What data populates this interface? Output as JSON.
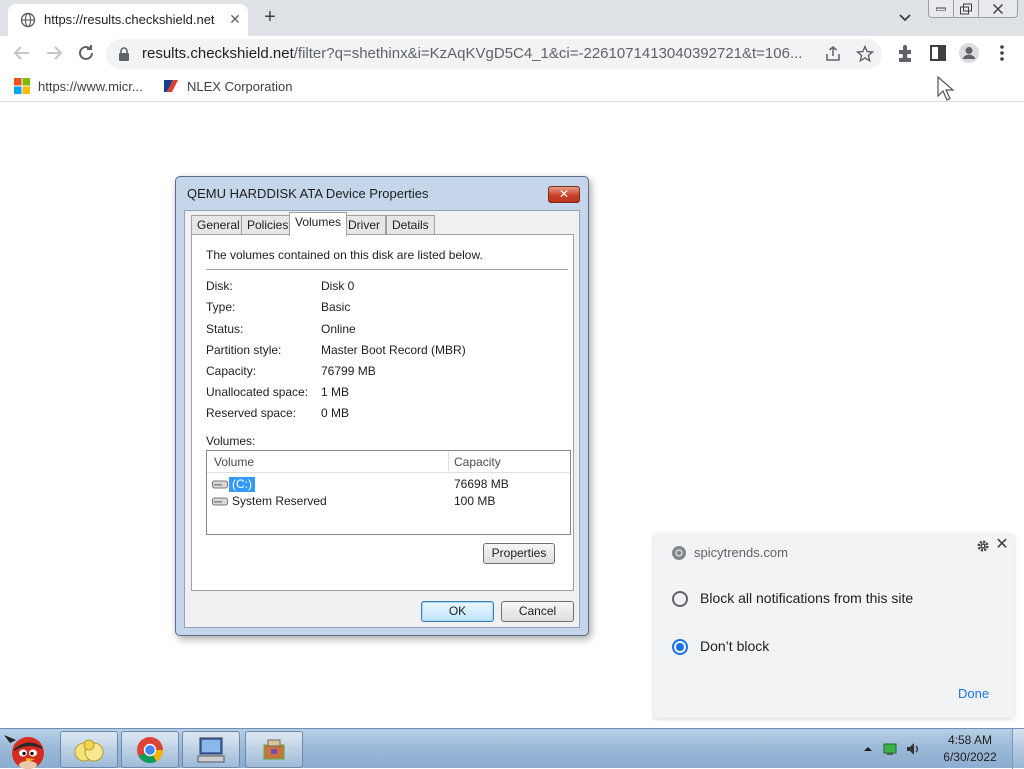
{
  "browser": {
    "tab_title": "https://results.checkshield.net",
    "url_host": "results.checkshield.net",
    "url_rest": "/filter?q=shethinx&i=KzAqKVgD5C4_1&ci=-2261071413040392721&t=106...",
    "bookmarks": [
      {
        "label": "https://www.micr...",
        "icon": "microsoft-logo-icon"
      },
      {
        "label": "NLEX Corporation",
        "icon": "nlex-logo-icon"
      }
    ]
  },
  "dialog": {
    "title": "QEMU HARDDISK ATA Device Properties",
    "close_label": "✕",
    "tabs": [
      "General",
      "Policies",
      "Volumes",
      "Driver",
      "Details"
    ],
    "active_tab": "Volumes",
    "intro": "The volumes contained on this disk are listed below.",
    "properties": [
      {
        "label": "Disk:",
        "value": "Disk 0"
      },
      {
        "label": "Type:",
        "value": "Basic"
      },
      {
        "label": "Status:",
        "value": "Online"
      },
      {
        "label": "Partition style:",
        "value": "Master Boot Record (MBR)"
      },
      {
        "label": "Capacity:",
        "value": "76799 MB"
      },
      {
        "label": "Unallocated space:",
        "value": "1 MB"
      },
      {
        "label": "Reserved space:",
        "value": "0 MB"
      }
    ],
    "volumes_label": "Volumes:",
    "volume_columns": [
      "Volume",
      "Capacity"
    ],
    "volumes": [
      {
        "name": "(C:)",
        "capacity": "76698 MB",
        "selected": true
      },
      {
        "name": "System Reserved",
        "capacity": "100 MB",
        "selected": false
      }
    ],
    "properties_button": "Properties",
    "ok_button": "OK",
    "cancel_button": "Cancel"
  },
  "notification": {
    "site": "spicytrends.com",
    "options": [
      {
        "label": "Block all notifications from this site",
        "checked": false
      },
      {
        "label": "Don’t block",
        "checked": true
      }
    ],
    "done_label": "Done"
  },
  "taskbar": {
    "time": "4:58 AM",
    "date": "6/30/2022"
  },
  "colors": {
    "chrome_tabstrip": "#dee1e6",
    "accent_blue": "#1a73e8",
    "dialog_frame": "#c6d6ea",
    "taskbar": "#9ab8d7"
  }
}
